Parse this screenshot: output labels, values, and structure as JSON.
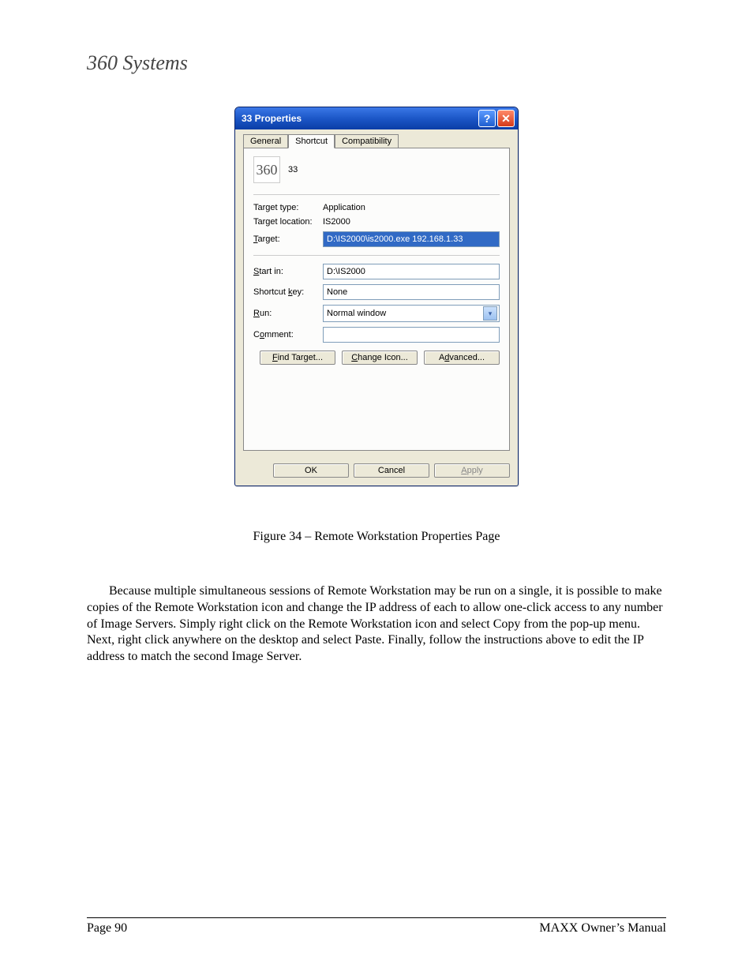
{
  "brand": "360 Systems",
  "dialog": {
    "title": "33 Properties",
    "help_label": "?",
    "close_label": "✕",
    "tabs": {
      "general": "General",
      "shortcut": "Shortcut",
      "compatibility": "Compatibility"
    },
    "shortcut_name": "33",
    "labels": {
      "target_type": "Target type:",
      "target_location": "Target location:",
      "target": "Target:",
      "start_in": "Start in:",
      "shortcut_key": "Shortcut key:",
      "run": "Run:",
      "comment": "Comment:"
    },
    "hot": {
      "t": "T",
      "s": "S",
      "k": "k",
      "r": "R",
      "o": "o"
    },
    "values": {
      "target_type": "Application",
      "target_location": "IS2000",
      "target": "D:\\IS2000\\is2000.exe 192.168.1.33",
      "start_in": "D:\\IS2000",
      "shortcut_key": "None",
      "run": "Normal window",
      "comment": ""
    },
    "buttons": {
      "find_target": "Find Target...",
      "change_icon": "Change Icon...",
      "advanced": "Advanced...",
      "ok": "OK",
      "cancel": "Cancel",
      "apply": "Apply"
    },
    "hot_btn": {
      "f": "F",
      "c": "C",
      "d": "d",
      "a": "A"
    }
  },
  "caption": "Figure 34 – Remote Workstation Properties Page",
  "paragraph": "Because multiple simultaneous sessions of Remote Workstation may be run on a single, it is possible to make copies of the Remote Workstation icon and change the IP address of each to allow one-click access to any number of Image Servers. Simply right click on the Remote Workstation icon and select Copy from the pop-up menu.  Next, right click anywhere on the desktop and select Paste.  Finally, follow the instructions above to edit the IP address to match the second Image Server.",
  "footer": {
    "left": "Page 90",
    "right": "MAXX Owner’s Manual"
  }
}
